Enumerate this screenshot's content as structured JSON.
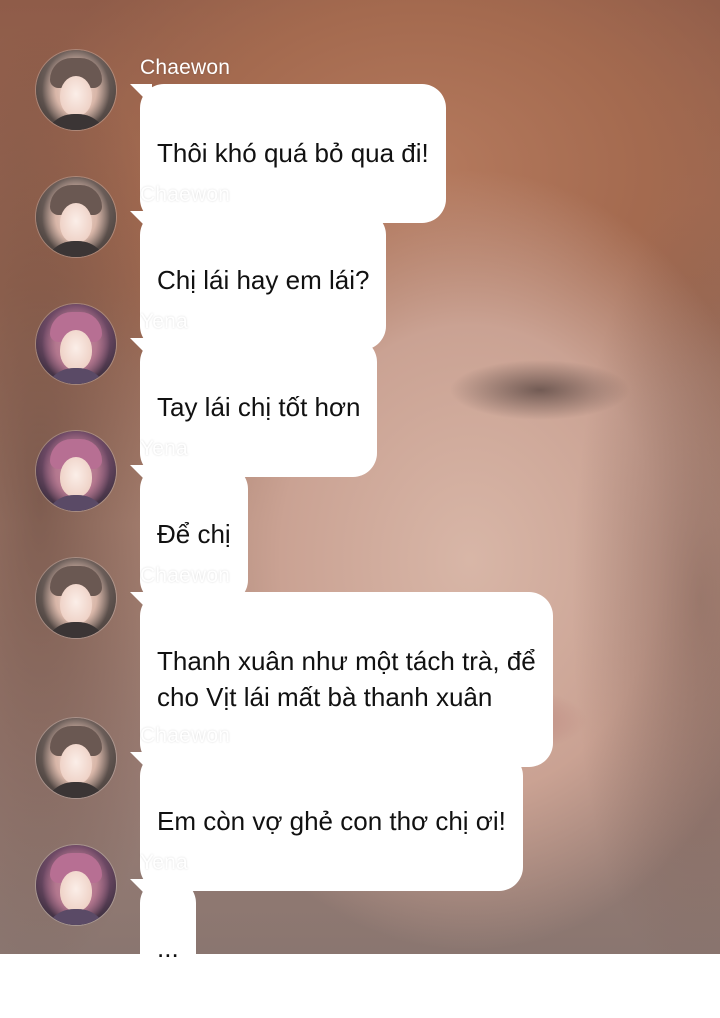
{
  "thread": {
    "messages": [
      {
        "sender": "Chaewon",
        "avatar": "chaewon",
        "text": "Thôi khó quá bỏ qua đi!"
      },
      {
        "sender": "Chaewon",
        "avatar": "chaewon",
        "text": "Chị lái hay em lái?"
      },
      {
        "sender": "Yena",
        "avatar": "yena",
        "text": "Tay lái chị tốt hơn"
      },
      {
        "sender": "Yena",
        "avatar": "yena",
        "text": "Để chị"
      },
      {
        "sender": "Chaewon",
        "avatar": "chaewon",
        "text": "Thanh xuân như một tách trà, để\ncho Vịt lái mất bà thanh xuân"
      },
      {
        "sender": "Chaewon",
        "avatar": "chaewon",
        "text": "Em còn vợ ghẻ con thơ chị ơi!"
      },
      {
        "sender": "Yena",
        "avatar": "yena",
        "text": "..."
      }
    ]
  },
  "colors": {
    "bubble": "#ffffff",
    "bubble_text": "#111111",
    "name_text": "#ffffff"
  }
}
